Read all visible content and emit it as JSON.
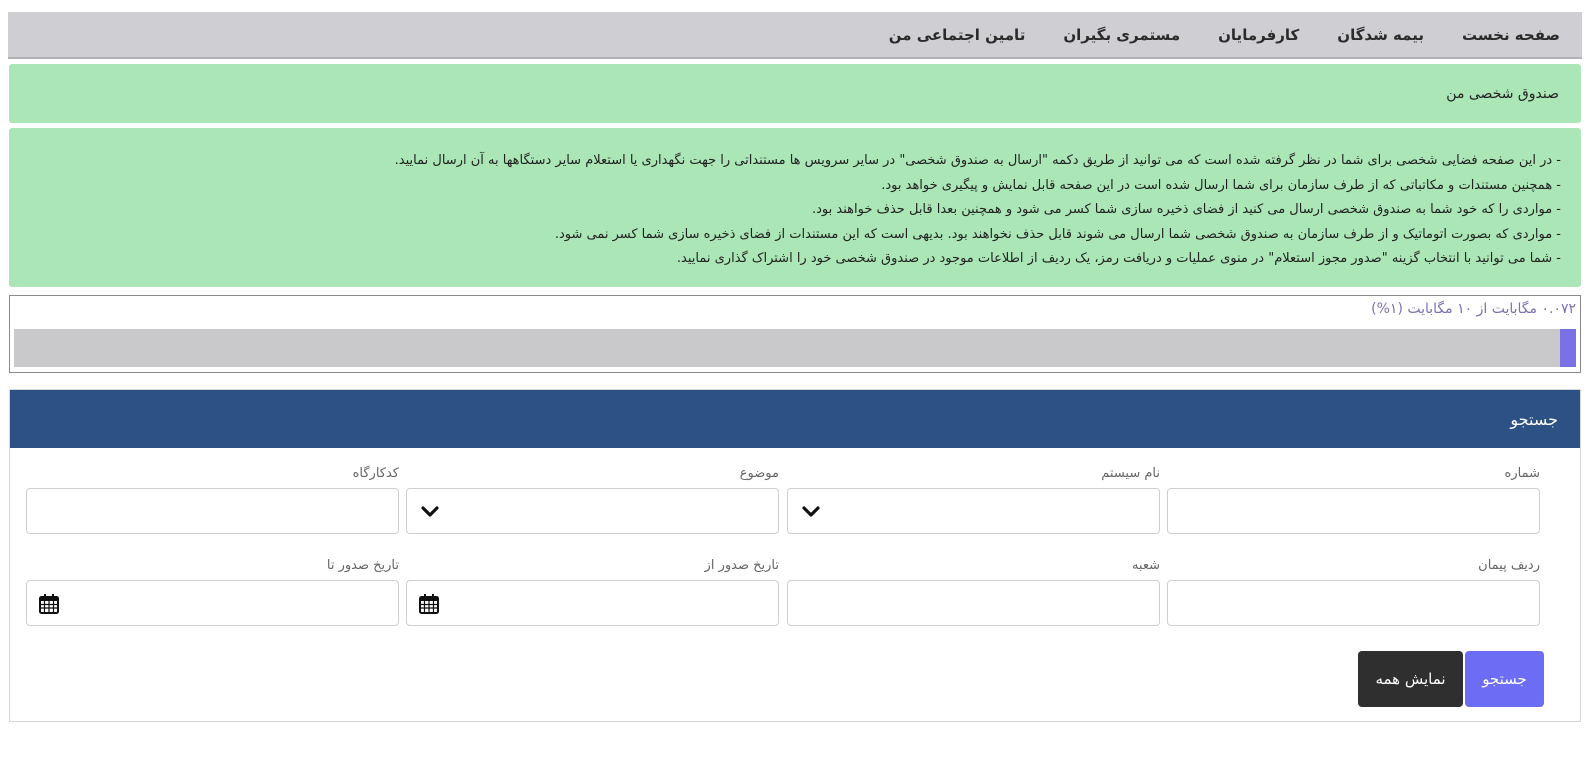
{
  "nav": {
    "items": [
      {
        "label": "صفحه نخست"
      },
      {
        "label": "بیمه شدگان"
      },
      {
        "label": "کارفرمایان"
      },
      {
        "label": "مستمری بگیران"
      },
      {
        "label": "تامین اجتماعی من"
      }
    ]
  },
  "page_title": "صندوق شخصی من",
  "info": {
    "lines": [
      "- در این صفحه فضایی شخصی برای شما در نظر گرفته شده است که می توانید از طریق دکمه \"ارسال به صندوق شخصی\" در سایر سرویس ها مستنداتی را جهت نگهداری یا استعلام سایر دستگاهها به آن ارسال نمایید.",
      "- همچنین مستندات و مکاتباتی که از طرف سازمان برای شما ارسال شده است در این صفحه قابل نمایش و پیگیری خواهد بود.",
      "- مواردی را که خود شما به صندوق شخصی ارسال می کنید از فضای ذخیره سازی شما کسر می شود و همچنین بعدا قابل حذف خواهند بود.",
      "- مواردی که بصورت اتوماتیک و از طرف سازمان به صندوق شخصی شما ارسال می شوند قابل حذف نخواهند بود. بدیهی است که این مستندات از فضای ذخیره سازی شما کسر نمی شود.",
      "- شما می توانید با انتخاب گزینه \"صدور مجوز استعلام\" در منوی عملیات و دریافت رمز، یک ردیف از اطلاعات موجود در صندوق شخصی خود را اشتراک گذاری نمایید."
    ]
  },
  "storage": {
    "label": "۰.۰۷۲ مگابایت از ۱۰ مگابایت (۱%)",
    "used_percent": 1
  },
  "search": {
    "header": "جستجو",
    "fields": {
      "number": {
        "label": "شماره",
        "value": ""
      },
      "system_name": {
        "label": "نام سیستم",
        "value": ""
      },
      "subject": {
        "label": "موضوع",
        "value": ""
      },
      "workshop_code": {
        "label": "کدکارگاه",
        "value": ""
      },
      "contract_row": {
        "label": "ردیف پیمان",
        "value": ""
      },
      "branch": {
        "label": "شعبه",
        "value": ""
      },
      "issue_date_from": {
        "label": "تاریخ صدور از",
        "value": ""
      },
      "issue_date_to": {
        "label": "تاریخ صدور تا",
        "value": ""
      }
    },
    "search_button": "جستجو",
    "show_all_button": "نمایش همه"
  },
  "colors": {
    "nav_bg": "#cfcfd3",
    "notice_bg": "#abe6b7",
    "panel_header": "#2d5185",
    "progress_fill": "#7b70e6",
    "search_button": "#6c6cf5",
    "show_all_button": "#2f2f2f"
  },
  "icons": {
    "dropdown": "chevron-down-icon",
    "date": "calendar-icon"
  }
}
